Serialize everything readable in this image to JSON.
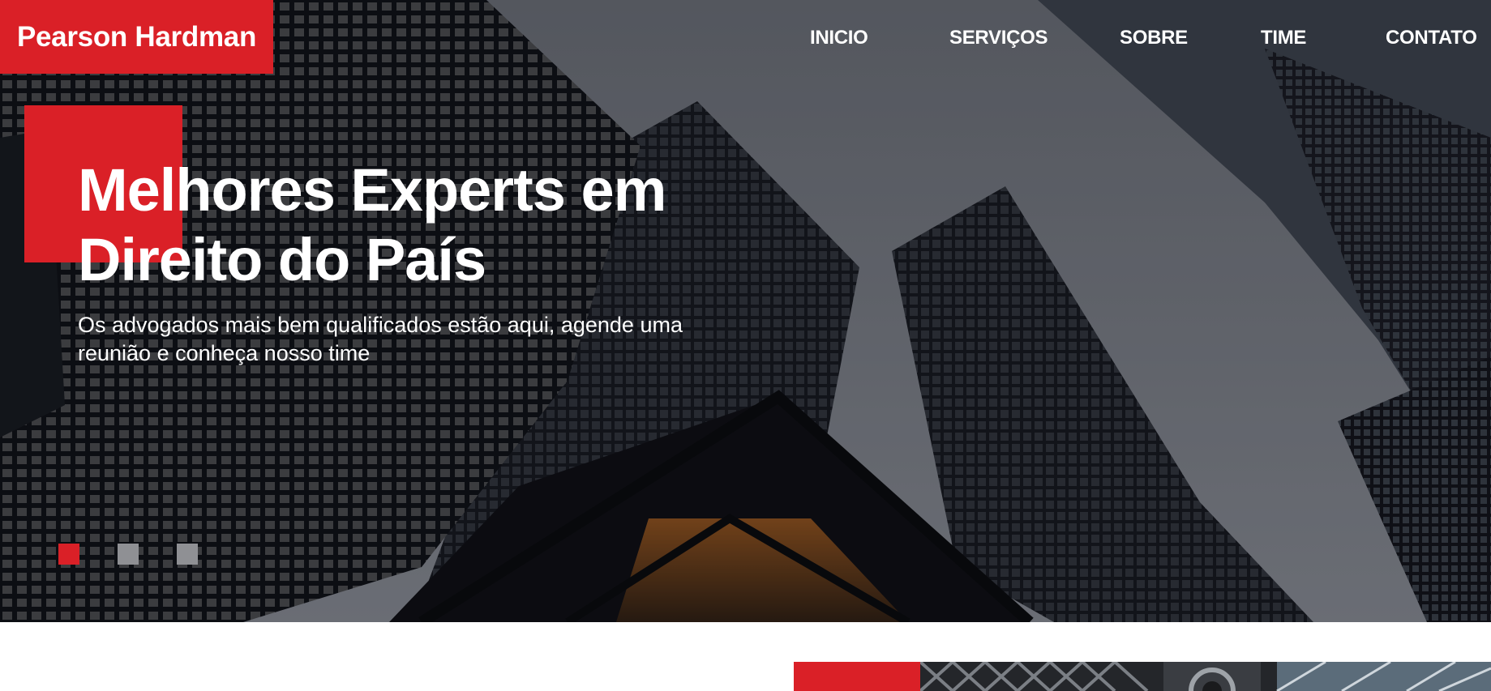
{
  "brand": {
    "name": "Pearson Hardman",
    "accent_color": "#da2027"
  },
  "nav": {
    "items": [
      {
        "label": "INICIO"
      },
      {
        "label": "SERVIÇOS"
      },
      {
        "label": "SOBRE"
      },
      {
        "label": "TIME"
      },
      {
        "label": "CONTATO"
      }
    ]
  },
  "hero": {
    "title_line1": "Melhores Experts em",
    "title_line2": "Direito do País",
    "subtitle_line1": "Os advogados mais bem qualificados estão aqui, agende uma",
    "subtitle_line2": "reunião e conheça nosso time",
    "background": "skyscrapers-photo",
    "slides": {
      "count": 3,
      "active_index": 0
    }
  }
}
